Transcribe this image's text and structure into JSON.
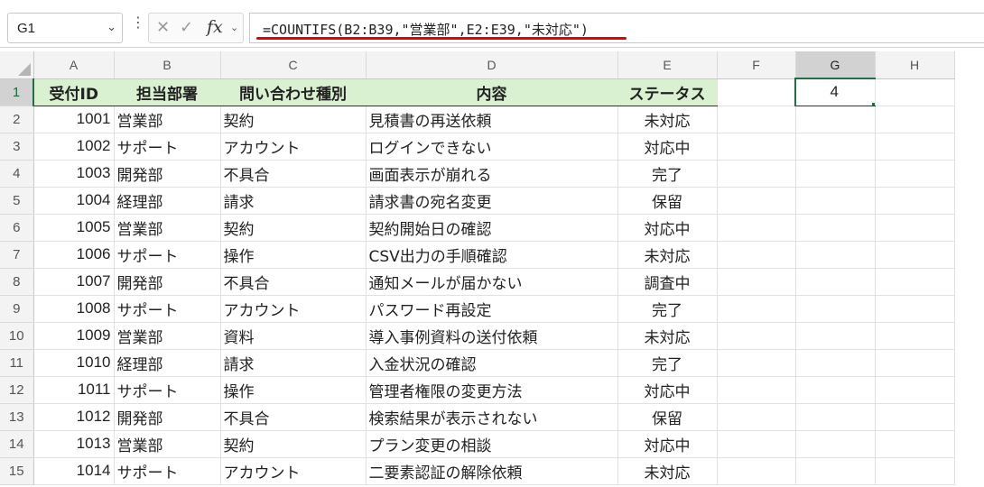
{
  "namebox": {
    "value": "G1"
  },
  "formula_bar": {
    "cancel_icon": "close-icon",
    "enter_icon": "check-icon",
    "fx_label": "fx",
    "formula": "=COUNTIFS(B2:B39,\"営業部\",E2:E39,\"未対応\")",
    "highlight_color": "#e30000"
  },
  "columns": [
    "A",
    "B",
    "C",
    "D",
    "E",
    "F",
    "G",
    "H"
  ],
  "selected_column": "G",
  "header_row": {
    "row_number": "1",
    "cells": [
      "受付ID",
      "担当部署",
      "問い合わせ種別",
      "内容",
      "ステータス"
    ],
    "g1_value": "4",
    "fill_color": "#d9f0d1"
  },
  "rows": [
    {
      "n": "2",
      "id": "1001",
      "dept": "営業部",
      "type": "契約",
      "content": "見積書の再送依頼",
      "status": "未対応"
    },
    {
      "n": "3",
      "id": "1002",
      "dept": "サポート",
      "type": "アカウント",
      "content": "ログインできない",
      "status": "対応中"
    },
    {
      "n": "4",
      "id": "1003",
      "dept": "開発部",
      "type": "不具合",
      "content": "画面表示が崩れる",
      "status": "完了"
    },
    {
      "n": "5",
      "id": "1004",
      "dept": "経理部",
      "type": "請求",
      "content": "請求書の宛名変更",
      "status": "保留"
    },
    {
      "n": "6",
      "id": "1005",
      "dept": "営業部",
      "type": "契約",
      "content": "契約開始日の確認",
      "status": "対応中"
    },
    {
      "n": "7",
      "id": "1006",
      "dept": "サポート",
      "type": "操作",
      "content": "CSV出力の手順確認",
      "status": "未対応"
    },
    {
      "n": "8",
      "id": "1007",
      "dept": "開発部",
      "type": "不具合",
      "content": "通知メールが届かない",
      "status": "調査中"
    },
    {
      "n": "9",
      "id": "1008",
      "dept": "サポート",
      "type": "アカウント",
      "content": "パスワード再設定",
      "status": "完了"
    },
    {
      "n": "10",
      "id": "1009",
      "dept": "営業部",
      "type": "資料",
      "content": "導入事例資料の送付依頼",
      "status": "未対応"
    },
    {
      "n": "11",
      "id": "1010",
      "dept": "経理部",
      "type": "請求",
      "content": "入金状況の確認",
      "status": "完了"
    },
    {
      "n": "12",
      "id": "1011",
      "dept": "サポート",
      "type": "操作",
      "content": "管理者権限の変更方法",
      "status": "対応中"
    },
    {
      "n": "13",
      "id": "1012",
      "dept": "開発部",
      "type": "不具合",
      "content": "検索結果が表示されない",
      "status": "保留"
    },
    {
      "n": "14",
      "id": "1013",
      "dept": "営業部",
      "type": "契約",
      "content": "プラン変更の相談",
      "status": "対応中"
    },
    {
      "n": "15",
      "id": "1014",
      "dept": "サポート",
      "type": "アカウント",
      "content": "二要素認証の解除依頼",
      "status": "未対応"
    }
  ]
}
